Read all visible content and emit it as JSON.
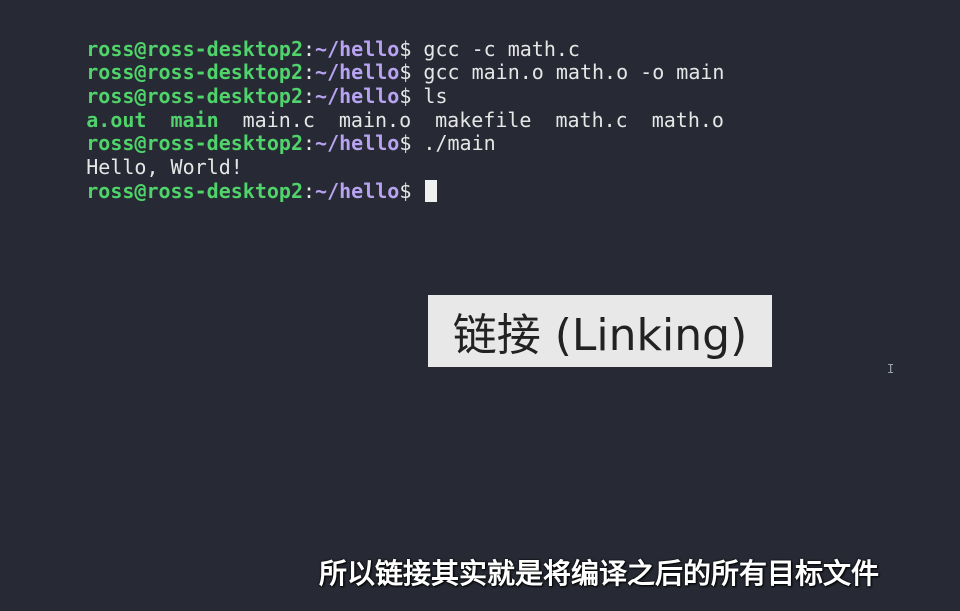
{
  "terminal": {
    "prompt": {
      "user_host": "ross@ross-desktop2",
      "colon": ":",
      "path": "~/hello",
      "dollar": "$"
    },
    "lines": [
      {
        "type": "prompt",
        "command": " gcc -c math.c"
      },
      {
        "type": "prompt",
        "command": " gcc main.o math.o -o main"
      },
      {
        "type": "prompt",
        "command": " ls"
      },
      {
        "type": "ls_output",
        "files": [
          "a.out",
          "main",
          "main.c",
          "main.o",
          "makefile",
          "math.c",
          "math.o"
        ]
      },
      {
        "type": "prompt",
        "command": " ./main"
      },
      {
        "type": "output",
        "text": "Hello, World!"
      },
      {
        "type": "prompt",
        "command": " "
      }
    ]
  },
  "overlay": {
    "title": "链接 (Linking)"
  },
  "subtitle": {
    "text": "所以链接其实就是将编译之后的所有目标文件"
  },
  "colors": {
    "background": "#272a34",
    "user_host": "#4fd36a",
    "path": "#b8a3f2",
    "text": "#e6e6e6"
  },
  "icons": {
    "mouse_cursor": "text-ibeam-icon"
  }
}
